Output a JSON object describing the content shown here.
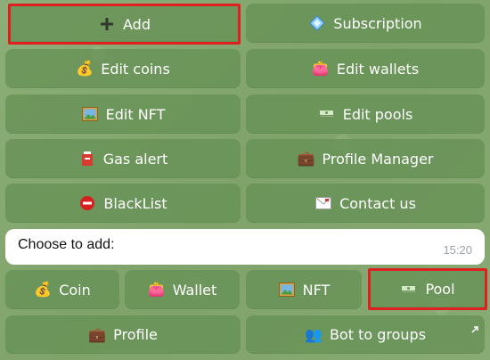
{
  "menu": {
    "add_label": "Add",
    "subscription_label": "Subscription",
    "edit_coins_label": "Edit coins",
    "edit_wallets_label": "Edit wallets",
    "edit_nft_label": "Edit NFT",
    "edit_pools_label": "Edit pools",
    "gas_alert_label": "Gas alert",
    "profile_manager_label": "Profile Manager",
    "blacklist_label": "BlackList",
    "contact_us_label": "Contact us"
  },
  "message": {
    "text": "Choose to add:",
    "time": "15:20"
  },
  "add_menu": {
    "coin_label": "Coin",
    "wallet_label": "Wallet",
    "nft_label": "NFT",
    "pool_label": "Pool",
    "profile_label": "Profile",
    "bot_to_groups_label": "Bot to groups"
  },
  "icons": {
    "add": "plus-icon",
    "subscription": "diamond-icon",
    "edit_coins": "money-bag-icon",
    "edit_wallets": "purse-icon",
    "edit_nft": "picture-icon",
    "edit_pools": "dollar-wad-icon",
    "gas_alert": "fuel-cup-icon",
    "profile_manager": "briefcase-icon",
    "blacklist": "no-entry-icon",
    "contact_us": "envelope-icon",
    "coin": "money-bag-icon",
    "wallet": "purse-icon",
    "nft": "picture-icon",
    "pool": "dollar-wad-icon",
    "profile": "briefcase-icon",
    "bot_to_groups": "people-icon"
  },
  "colors": {
    "highlight": "#e02020",
    "button_bg": "#6c9458",
    "background": "#86a872"
  }
}
